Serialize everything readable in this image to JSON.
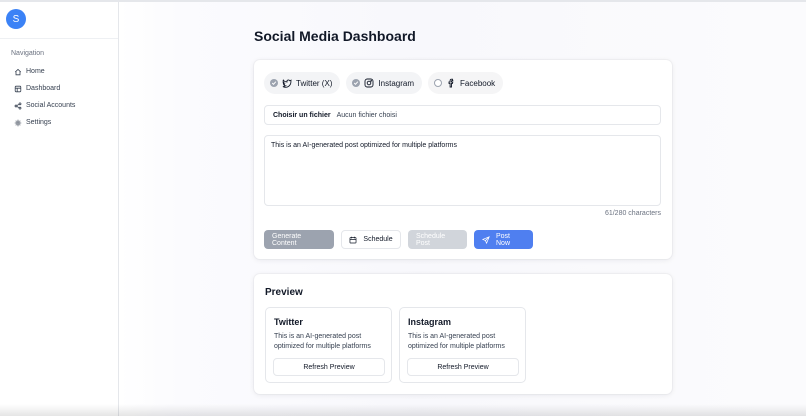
{
  "sidebar": {
    "avatar_initial": "S",
    "nav_title": "Navigation",
    "items": [
      {
        "label": "Home",
        "icon": "home-icon"
      },
      {
        "label": "Dashboard",
        "icon": "dashboard-icon"
      },
      {
        "label": "Social Accounts",
        "icon": "share-icon"
      },
      {
        "label": "Settings",
        "icon": "gear-icon"
      }
    ]
  },
  "page": {
    "title": "Social Media Dashboard"
  },
  "compose": {
    "platforms": [
      {
        "label": "Twitter (X)",
        "selected": true,
        "icon": "twitter-icon"
      },
      {
        "label": "Instagram",
        "selected": true,
        "icon": "instagram-icon"
      },
      {
        "label": "Facebook",
        "selected": false,
        "icon": "facebook-icon"
      }
    ],
    "file_button": "Choisir un fichier",
    "file_status": "Aucun fichier choisi",
    "post_text": "This is an AI-generated post optimized for multiple platforms",
    "char_count": "61/280 characters",
    "buttons": {
      "generate": "Generate Content",
      "schedule": "Schedule",
      "schedule_post": "Schedule Post",
      "post_now": "Post Now"
    }
  },
  "preview": {
    "title": "Preview",
    "cards": [
      {
        "title": "Twitter",
        "body": "This is an AI-generated post optimized for multiple platforms",
        "button": "Refresh Preview"
      },
      {
        "title": "Instagram",
        "body": "This is an AI-generated post optimized for multiple platforms",
        "button": "Refresh Preview"
      }
    ]
  },
  "colors": {
    "accent": "#4f7ff0",
    "avatar": "#3b82f6",
    "muted_button": "#9ca3af",
    "disabled_button": "#d1d5db"
  }
}
